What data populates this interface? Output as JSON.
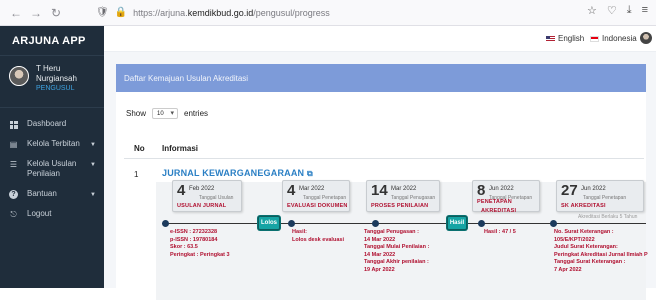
{
  "browser": {
    "url_prefix": "https://arjuna.",
    "url_domain": "kemdikbud.go.id",
    "url_path": "/pengusul/progress"
  },
  "sidebar": {
    "app_name": "ARJUNA APP",
    "user_name_line1": "T Heru",
    "user_name_line2": "Nurgiansah",
    "user_role": "PENGUSUL",
    "items": [
      {
        "label": "Dashboard"
      },
      {
        "label": "Kelola Terbitan"
      },
      {
        "label": "Kelola Usulan Penilaian"
      },
      {
        "label": "Bantuan"
      },
      {
        "label": "Logout"
      }
    ]
  },
  "topbar": {
    "lang_en": "English",
    "lang_id": "Indonesia"
  },
  "card": {
    "header": "Daftar Kemajuan Usulan Akreditasi",
    "show_label": "Show",
    "entries_value": "10",
    "entries_label": "entries",
    "col_no": "No",
    "col_info": "Informasi"
  },
  "row": {
    "num": "1",
    "journal_title": "JURNAL KEWARGANEGARAAN"
  },
  "timeline": {
    "steps": [
      {
        "day": "4",
        "mon": "Feb 2022",
        "sub": "Tanggal Usulan",
        "event": "USULAN JURNAL"
      },
      {
        "day": "4",
        "mon": "Mar 2022",
        "sub": "Tanggal Penetapan",
        "event": "EVALUASI DOKUMEN"
      },
      {
        "day": "14",
        "mon": "Mar 2022",
        "sub": "Tanggal Penugasan",
        "event": "PROSES PENILAIAN"
      },
      {
        "day": "8",
        "mon": "Jun 2022",
        "sub": "Tanggal Penetapan",
        "event": "PENETAPAN"
      },
      {
        "day": "27",
        "mon": "Jun 2022",
        "sub": "Tanggal Penetapan",
        "event": "SK AKREDITASI"
      }
    ],
    "event4_line2": "AKREDITASI",
    "badge_lolos": "Lolos",
    "badge_hasil": "Hasil",
    "note_berlaku": "Akreditasi Berlaku 5 Tahun",
    "info1": [
      "e-ISSN : 27232328",
      "p-ISSN : 19780184",
      "Skor : 63.5",
      "Peringkat : Peringkat 3"
    ],
    "info2": [
      "Hasil:",
      "Lolos desk evaluasi"
    ],
    "info3": [
      "Tanggal Penugasan :",
      "14 Mar 2022",
      "Tanggal Mulai Penilaian :",
      "14 Mar 2022",
      "Tanggal Akhir penilaian :",
      "19 Apr 2022"
    ],
    "info4": [
      "Hasil : 47 / 5"
    ],
    "info5": [
      "No. Surat Keterangan :",
      "105/E/KPT/2022",
      "Judul Surat Keterangan:",
      "Peringkat Akreditasi Jurnal Ilmiah P",
      "Tanggal Surat Keterangan :",
      "7 Apr 2022"
    ]
  }
}
